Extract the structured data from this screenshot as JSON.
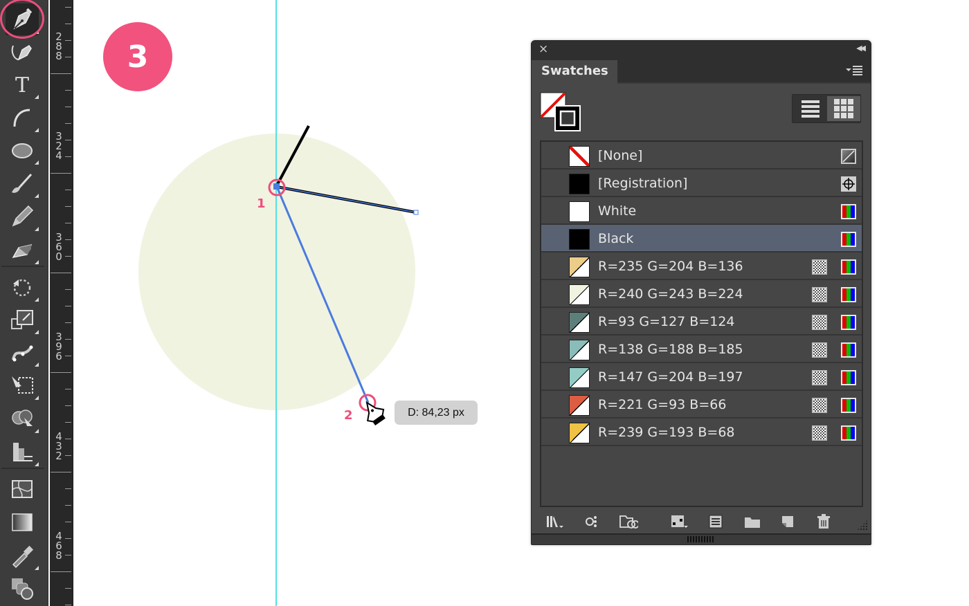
{
  "toolbar": {
    "active_tool": "pen",
    "tools": [
      {
        "id": "pen",
        "label": "Pen Tool"
      },
      {
        "id": "curvature",
        "label": "Curvature Tool"
      },
      {
        "id": "type",
        "label": "Type Tool"
      },
      {
        "id": "arc",
        "label": "Arc Tool"
      },
      {
        "id": "ellipse",
        "label": "Ellipse Tool"
      },
      {
        "id": "paintbrush",
        "label": "Paintbrush Tool"
      },
      {
        "id": "pencil",
        "label": "Pencil Tool"
      },
      {
        "id": "eraser",
        "label": "Eraser Tool"
      },
      {
        "id": "rotate",
        "label": "Rotate Tool"
      },
      {
        "id": "scale",
        "label": "Scale Tool"
      },
      {
        "id": "puppet-warp",
        "label": "Puppet Warp Tool"
      },
      {
        "id": "free-transform",
        "label": "Free Transform Tool"
      },
      {
        "id": "shape-builder",
        "label": "Shape Builder Tool"
      },
      {
        "id": "perspective-grid",
        "label": "Perspective Grid Tool"
      },
      {
        "id": "mesh",
        "label": "Mesh Tool"
      },
      {
        "id": "gradient",
        "label": "Gradient Tool"
      },
      {
        "id": "eyedropper",
        "label": "Eyedropper Tool"
      },
      {
        "id": "blend",
        "label": "Blend Tool"
      }
    ]
  },
  "ruler": {
    "labels": [
      "288",
      "324",
      "360",
      "396",
      "432",
      "468"
    ]
  },
  "canvas": {
    "step_badge": "3",
    "anchor_labels": [
      "1",
      "2"
    ],
    "distance_tooltip": "D: 84,23 px",
    "circle_fill": "#f0f3e0",
    "guide_color": "#53e0e6",
    "path_color": "#4a7be0",
    "highlight_color": "#ee4d7d"
  },
  "swatches_panel": {
    "title": "Swatches",
    "close_label": "×",
    "collapse_label": "◀◀",
    "view_modes": [
      "list-view",
      "thumbnail-view"
    ],
    "active_view": "thumbnail-view",
    "swatches": [
      {
        "name": "[None]",
        "color": "none",
        "type": "none",
        "global": false
      },
      {
        "name": "[Registration]",
        "color": "#000000",
        "type": "registration",
        "global": false
      },
      {
        "name": "White",
        "color": "#ffffff",
        "type": "rgb",
        "global": false
      },
      {
        "name": "Black",
        "color": "#000000",
        "type": "rgb",
        "global": false,
        "selected": true
      },
      {
        "name": "R=235 G=204 B=136",
        "color": "#ebcc88",
        "type": "rgb",
        "global": true
      },
      {
        "name": "R=240 G=243 B=224",
        "color": "#f0f3e0",
        "type": "rgb",
        "global": true
      },
      {
        "name": "R=93 G=127 B=124",
        "color": "#5d7f7c",
        "type": "rgb",
        "global": true
      },
      {
        "name": "R=138 G=188 B=185",
        "color": "#8abcb9",
        "type": "rgb",
        "global": true
      },
      {
        "name": "R=147 G=204 B=197",
        "color": "#93ccc5",
        "type": "rgb",
        "global": true
      },
      {
        "name": "R=221 G=93 B=66",
        "color": "#dd5d42",
        "type": "rgb",
        "global": true
      },
      {
        "name": "R=239 G=193 B=68",
        "color": "#efc144",
        "type": "rgb",
        "global": true
      }
    ],
    "footer_buttons": [
      {
        "id": "swatch-libraries",
        "label": "Swatch Libraries menu"
      },
      {
        "id": "show-swatch-kinds",
        "label": "Show Swatch Kinds menu"
      },
      {
        "id": "cc-libraries",
        "label": "Add to Library"
      },
      {
        "id": "swatch-options",
        "label": "Swatch Options"
      },
      {
        "id": "new-color-group",
        "label": "New Color Group"
      },
      {
        "id": "open-folder",
        "label": "Open Color Group"
      },
      {
        "id": "new-swatch",
        "label": "New Swatch"
      },
      {
        "id": "delete-swatch",
        "label": "Delete Swatch"
      }
    ]
  }
}
